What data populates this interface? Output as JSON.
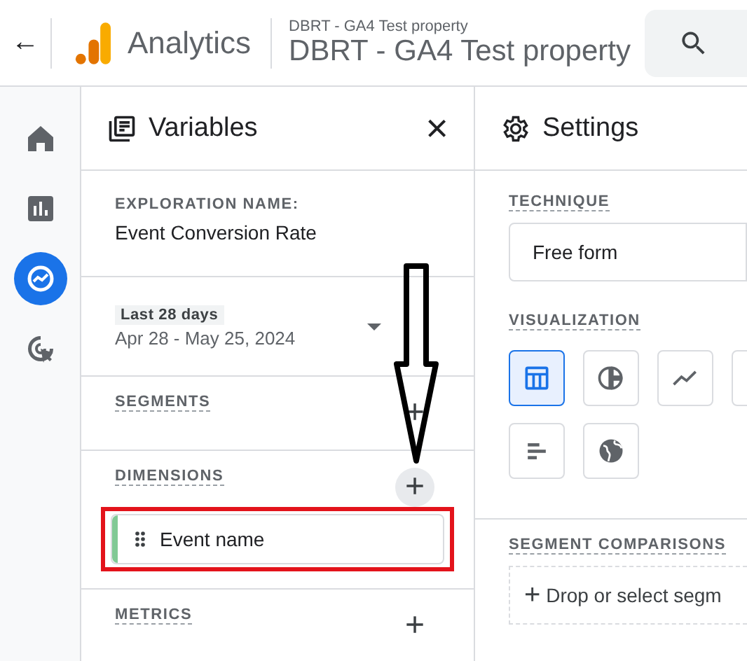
{
  "header": {
    "back": "←",
    "product": "Analytics",
    "property_small": "DBRT - GA4 Test property",
    "property_large": "DBRT - GA4 Test property"
  },
  "nav": [
    {
      "kind": "home",
      "selected": false
    },
    {
      "kind": "reports",
      "selected": false
    },
    {
      "kind": "explore",
      "selected": true
    },
    {
      "kind": "advertising",
      "selected": false
    }
  ],
  "variables": {
    "title": "Variables",
    "close": "×",
    "exploration_label": "EXPLORATION NAME:",
    "exploration_name": "Event Conversion Rate",
    "date_label": "Last 28 days",
    "date_range": "Apr 28 - May 25, 2024",
    "sections": [
      {
        "title": "SEGMENTS",
        "add": "+"
      },
      {
        "title": "DIMENSIONS",
        "add": "+",
        "highlighted_add": true,
        "items": [
          {
            "label": "Event name",
            "color": "#81c995",
            "annotated": true
          }
        ]
      },
      {
        "title": "METRICS",
        "add": "+"
      }
    ]
  },
  "settings": {
    "title": "Settings",
    "technique_label": "TECHNIQUE",
    "technique": "Free form",
    "visualization_label": "VISUALIZATION",
    "visualizations": [
      {
        "kind": "table",
        "selected": true
      },
      {
        "kind": "donut",
        "selected": false
      },
      {
        "kind": "line",
        "selected": false
      },
      {
        "kind": "cut_off",
        "selected": false
      },
      {
        "kind": "bar",
        "selected": false
      },
      {
        "kind": "geo",
        "selected": false
      }
    ],
    "segment_comparisons_label": "SEGMENT COMPARISONS",
    "drop_plus": "+",
    "drop_text": "Drop or select segm"
  }
}
